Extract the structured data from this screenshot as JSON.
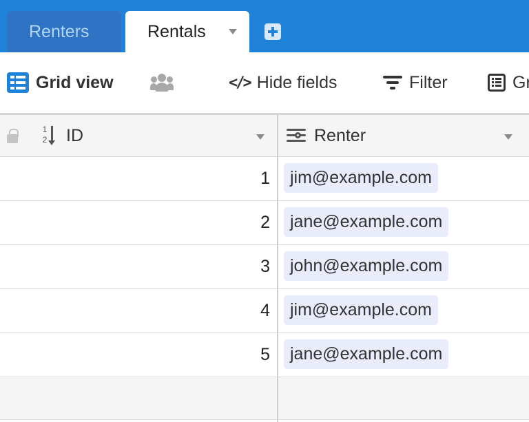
{
  "tabs": [
    {
      "label": "Renters",
      "active": false
    },
    {
      "label": "Rentals",
      "active": true
    }
  ],
  "toolbar": {
    "view_label": "Grid view",
    "hide_fields_label": "Hide fields",
    "filter_label": "Filter",
    "group_label": "Gr"
  },
  "columns": {
    "id": "ID",
    "renter": "Renter"
  },
  "sort_icon": {
    "top": "1",
    "bottom": "2"
  },
  "rows": [
    {
      "id": "1",
      "renter": "jim@example.com"
    },
    {
      "id": "2",
      "renter": "jane@example.com"
    },
    {
      "id": "3",
      "renter": "john@example.com"
    },
    {
      "id": "4",
      "renter": "jim@example.com"
    },
    {
      "id": "5",
      "renter": "jane@example.com"
    }
  ],
  "colors": {
    "accent": "#1e83d8",
    "chip_bg": "#e8ecfb",
    "header_bg": "#f5f5f5"
  },
  "icons": [
    "grid-view-icon",
    "people-icon",
    "hide-fields-icon",
    "filter-icon",
    "group-icon",
    "lock-icon",
    "number-sort-icon",
    "link-field-icon",
    "add-tab-icon"
  ]
}
